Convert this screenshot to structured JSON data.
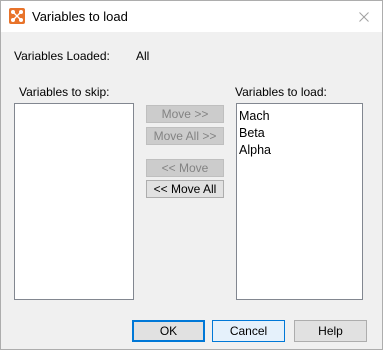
{
  "window": {
    "title": "Variables to load"
  },
  "status": {
    "loaded_label": "Variables Loaded:",
    "loaded_value": "All"
  },
  "skip_list": {
    "label": "Variables to skip:",
    "items": []
  },
  "load_list": {
    "label": "Variables to load:",
    "items": [
      "Mach",
      "Beta",
      "Alpha"
    ]
  },
  "move_buttons": {
    "move_right": "Move >>",
    "move_all_right": "Move All >>",
    "move_left": "<< Move",
    "move_all_left": "<< Move All"
  },
  "footer": {
    "ok": "OK",
    "cancel": "Cancel",
    "help": "Help"
  },
  "colors": {
    "accent": "#0078d7",
    "icon_orange": "#e8732a"
  }
}
